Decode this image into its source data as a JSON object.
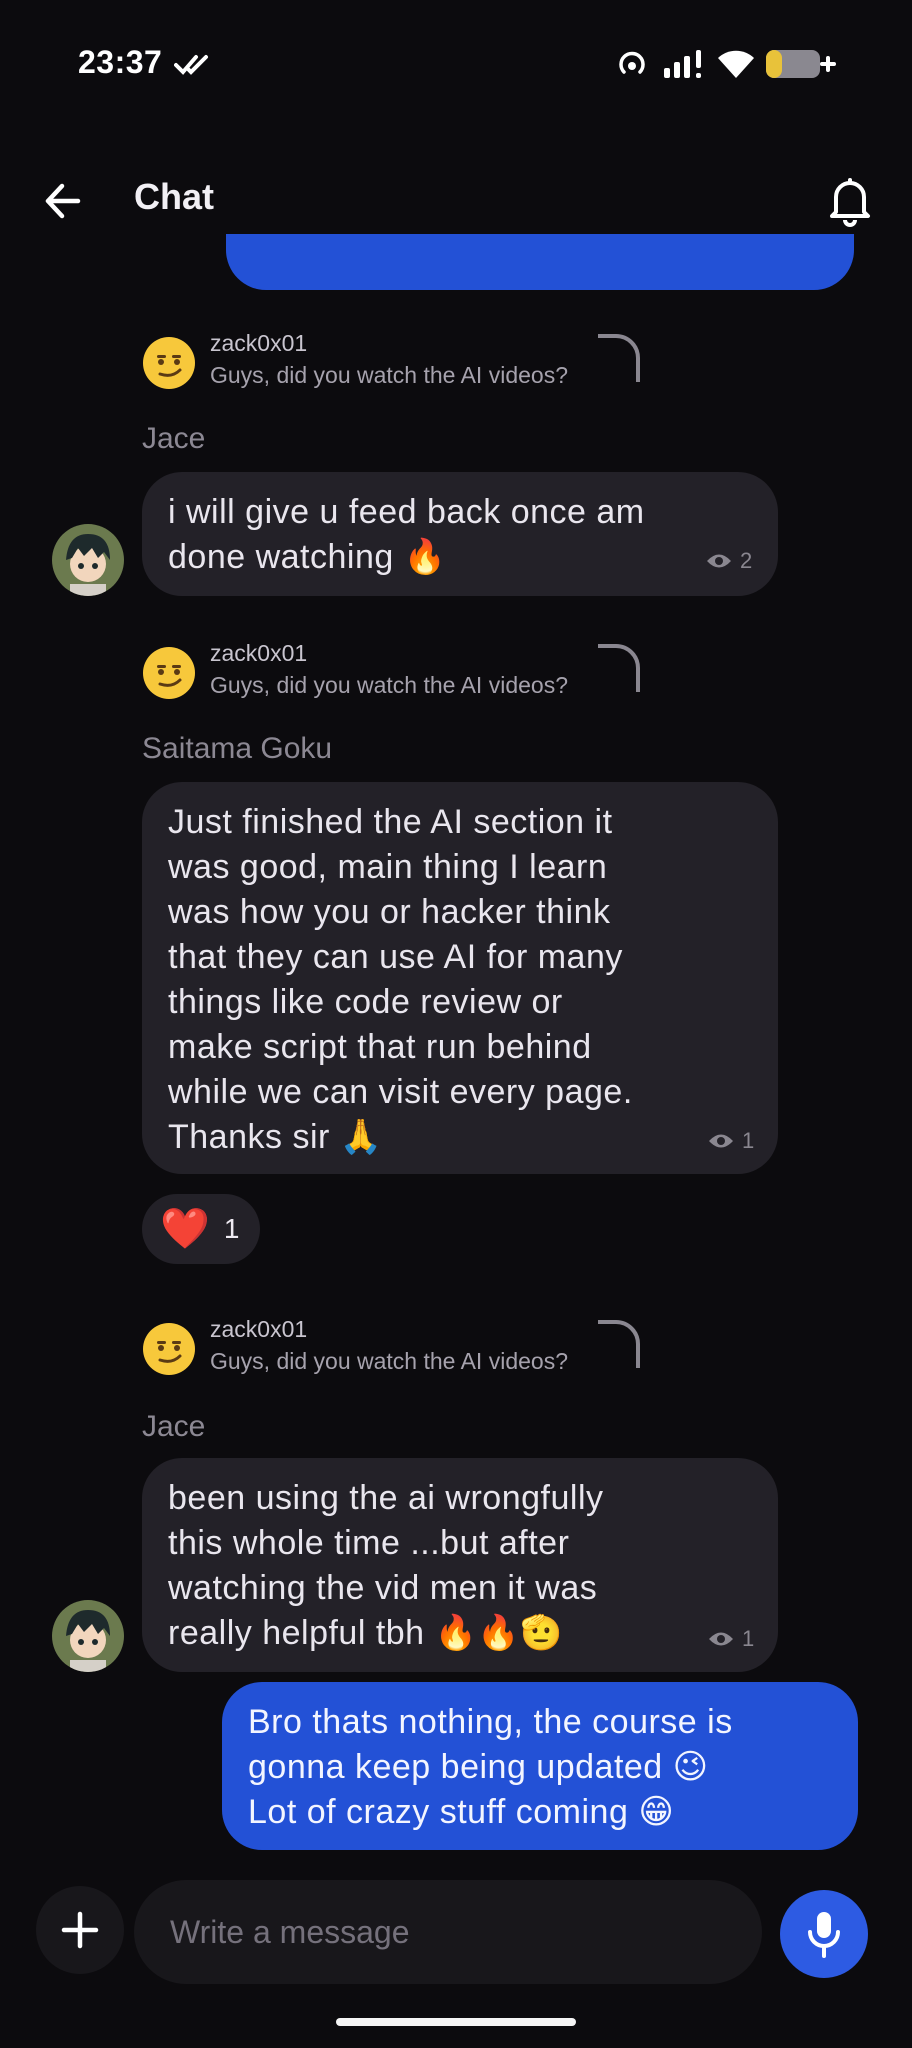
{
  "status": {
    "time": "23:37"
  },
  "header": {
    "title": "Chat"
  },
  "messages": [
    {
      "reply_name": "zack0x01",
      "reply_text": "Guys, did you watch the AI videos?",
      "sender": "Jace",
      "text_lines": [
        "i will give u feed back once am",
        "done watching 🔥"
      ],
      "views": "2"
    },
    {
      "reply_name": "zack0x01",
      "reply_text": "Guys, did you watch the AI videos?",
      "sender": "Saitama Goku",
      "text_lines": [
        "Just finished the AI section it",
        "was good, main thing I learn",
        "was how you or hacker think",
        "that they can use AI for many",
        "things like code review or",
        "make script that run behind",
        "while we can visit every page.",
        "Thanks sir 🙏"
      ],
      "views": "1",
      "reaction": {
        "emoji": "❤️",
        "count": "1"
      }
    },
    {
      "reply_name": "zack0x01",
      "reply_text": "Guys, did you watch the AI videos?",
      "sender": "Jace",
      "text_lines": [
        "been using the ai wrongfully",
        "this whole time ...but after",
        "watching the vid men it was",
        "really helpful tbh 🔥🔥🫡"
      ],
      "views": "1"
    },
    {
      "sender": "me",
      "text_lines": [
        "Bro thats nothing, the course is",
        "gonna keep being updated 😉",
        "Lot of crazy stuff coming 😁"
      ]
    }
  ],
  "composer": {
    "placeholder": "Write a message"
  },
  "colors": {
    "background": "#0c0b0e",
    "bubble": "#232128",
    "my_bubble": "#2351d6",
    "mic_button": "#2d5be3"
  },
  "icons": [
    "back-arrow-icon",
    "bell-icon",
    "plus-icon",
    "mic-icon",
    "eye-icon",
    "wifi-icon",
    "signal-icon",
    "battery-icon"
  ]
}
